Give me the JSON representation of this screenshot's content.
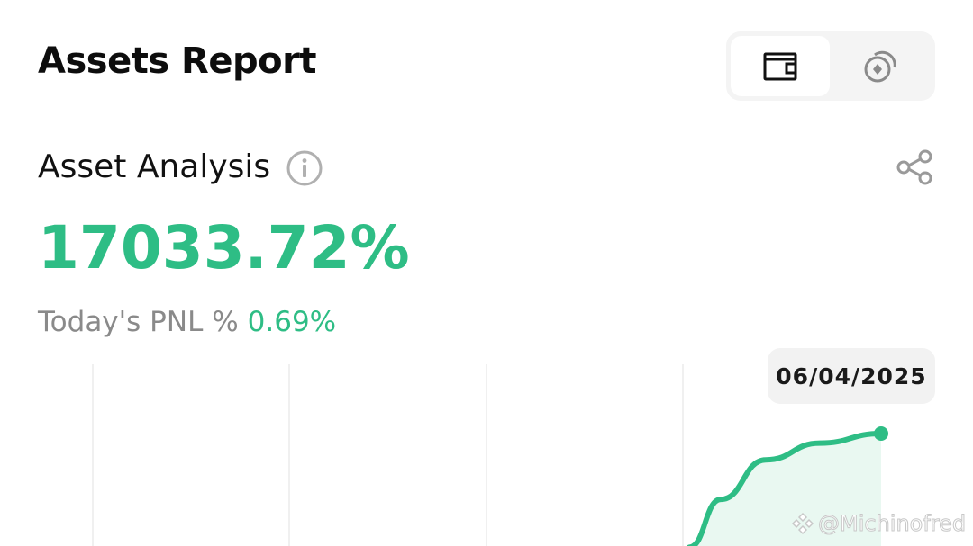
{
  "header": {
    "title": "Assets Report",
    "toggle": {
      "selected": "wallet-view",
      "options": [
        {
          "icon": "wallet-icon"
        },
        {
          "icon": "coin-rotate-icon"
        }
      ]
    }
  },
  "analysis": {
    "title": "Asset Analysis",
    "info_icon": "info-icon",
    "share_icon": "share-icon",
    "total_pnl_percent": "17033.72%",
    "today_label": "Today's PNL %",
    "today_value": "0.69%"
  },
  "chart_data": {
    "type": "area",
    "x": [
      "",
      "",
      "",
      "",
      "06/04/2025"
    ],
    "series": [
      {
        "values": [
          0.05,
          0.45,
          0.78,
          0.92,
          1.0
        ]
      }
    ],
    "tooltip_label": "06/04/2025",
    "gridlines": "vertical",
    "line_color": "#2ebd85",
    "fill_color": "#e9f8f1"
  },
  "watermark": {
    "text": "@Michinofred",
    "icon": "binance-logo-icon"
  },
  "colors": {
    "positive": "#2ebd85",
    "muted": "#8a8a8a",
    "toggle_bg": "#f4f4f4"
  }
}
